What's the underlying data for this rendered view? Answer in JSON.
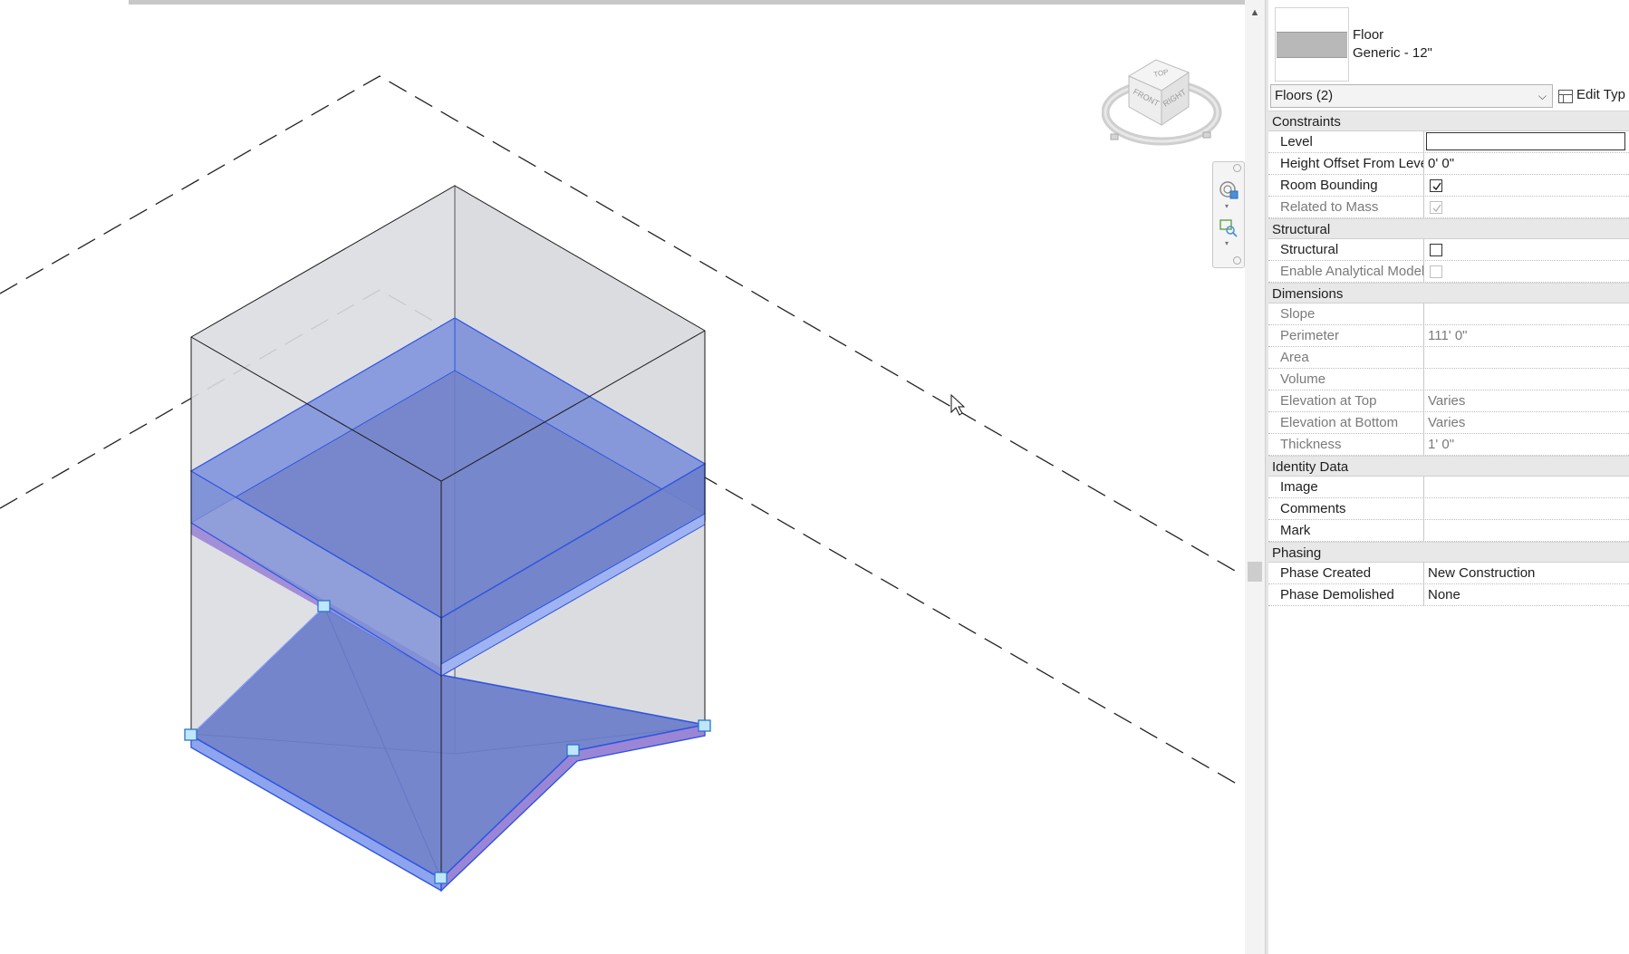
{
  "type_selector": {
    "family": "Floor",
    "type_name": "Generic - 12\"",
    "instance_filter": "Floors (2)",
    "edit_type_label": "Edit Typ"
  },
  "viewcube": {
    "top": "TOP",
    "front": "FRONT",
    "right": "RIGHT"
  },
  "properties": {
    "constraints": {
      "label": "Constraints",
      "level": {
        "name": "Level",
        "value": ""
      },
      "height_offset": {
        "name": "Height Offset From Level",
        "value": "0'  0\""
      },
      "room_bounding": {
        "name": "Room Bounding",
        "checked": true
      },
      "related_to_mass": {
        "name": "Related to Mass",
        "checked": true
      }
    },
    "structural": {
      "label": "Structural",
      "structural": {
        "name": "Structural",
        "checked": false
      },
      "analytical": {
        "name": "Enable Analytical Model",
        "checked": false
      }
    },
    "dimensions": {
      "label": "Dimensions",
      "slope": {
        "name": "Slope",
        "value": ""
      },
      "perimeter": {
        "name": "Perimeter",
        "value": "111'  0\""
      },
      "area": {
        "name": "Area",
        "value": ""
      },
      "volume": {
        "name": "Volume",
        "value": ""
      },
      "elev_top": {
        "name": "Elevation at Top",
        "value": "Varies"
      },
      "elev_bottom": {
        "name": "Elevation at Bottom",
        "value": "Varies"
      },
      "thickness": {
        "name": "Thickness",
        "value": "1'  0\""
      }
    },
    "identity": {
      "label": "Identity Data",
      "image": {
        "name": "Image",
        "value": ""
      },
      "comments": {
        "name": "Comments",
        "value": ""
      },
      "mark": {
        "name": "Mark",
        "value": ""
      }
    },
    "phasing": {
      "label": "Phasing",
      "created": {
        "name": "Phase Created",
        "value": "New Construction"
      },
      "demolished": {
        "name": "Phase Demolished",
        "value": "None"
      }
    }
  },
  "colors": {
    "floor_fill": "#6f7fca",
    "floor_edge": "#2f55e0",
    "mass_fill": "#dcdde0",
    "sloped_underside": "#9b86d6",
    "grip": "#bfe6ff"
  }
}
